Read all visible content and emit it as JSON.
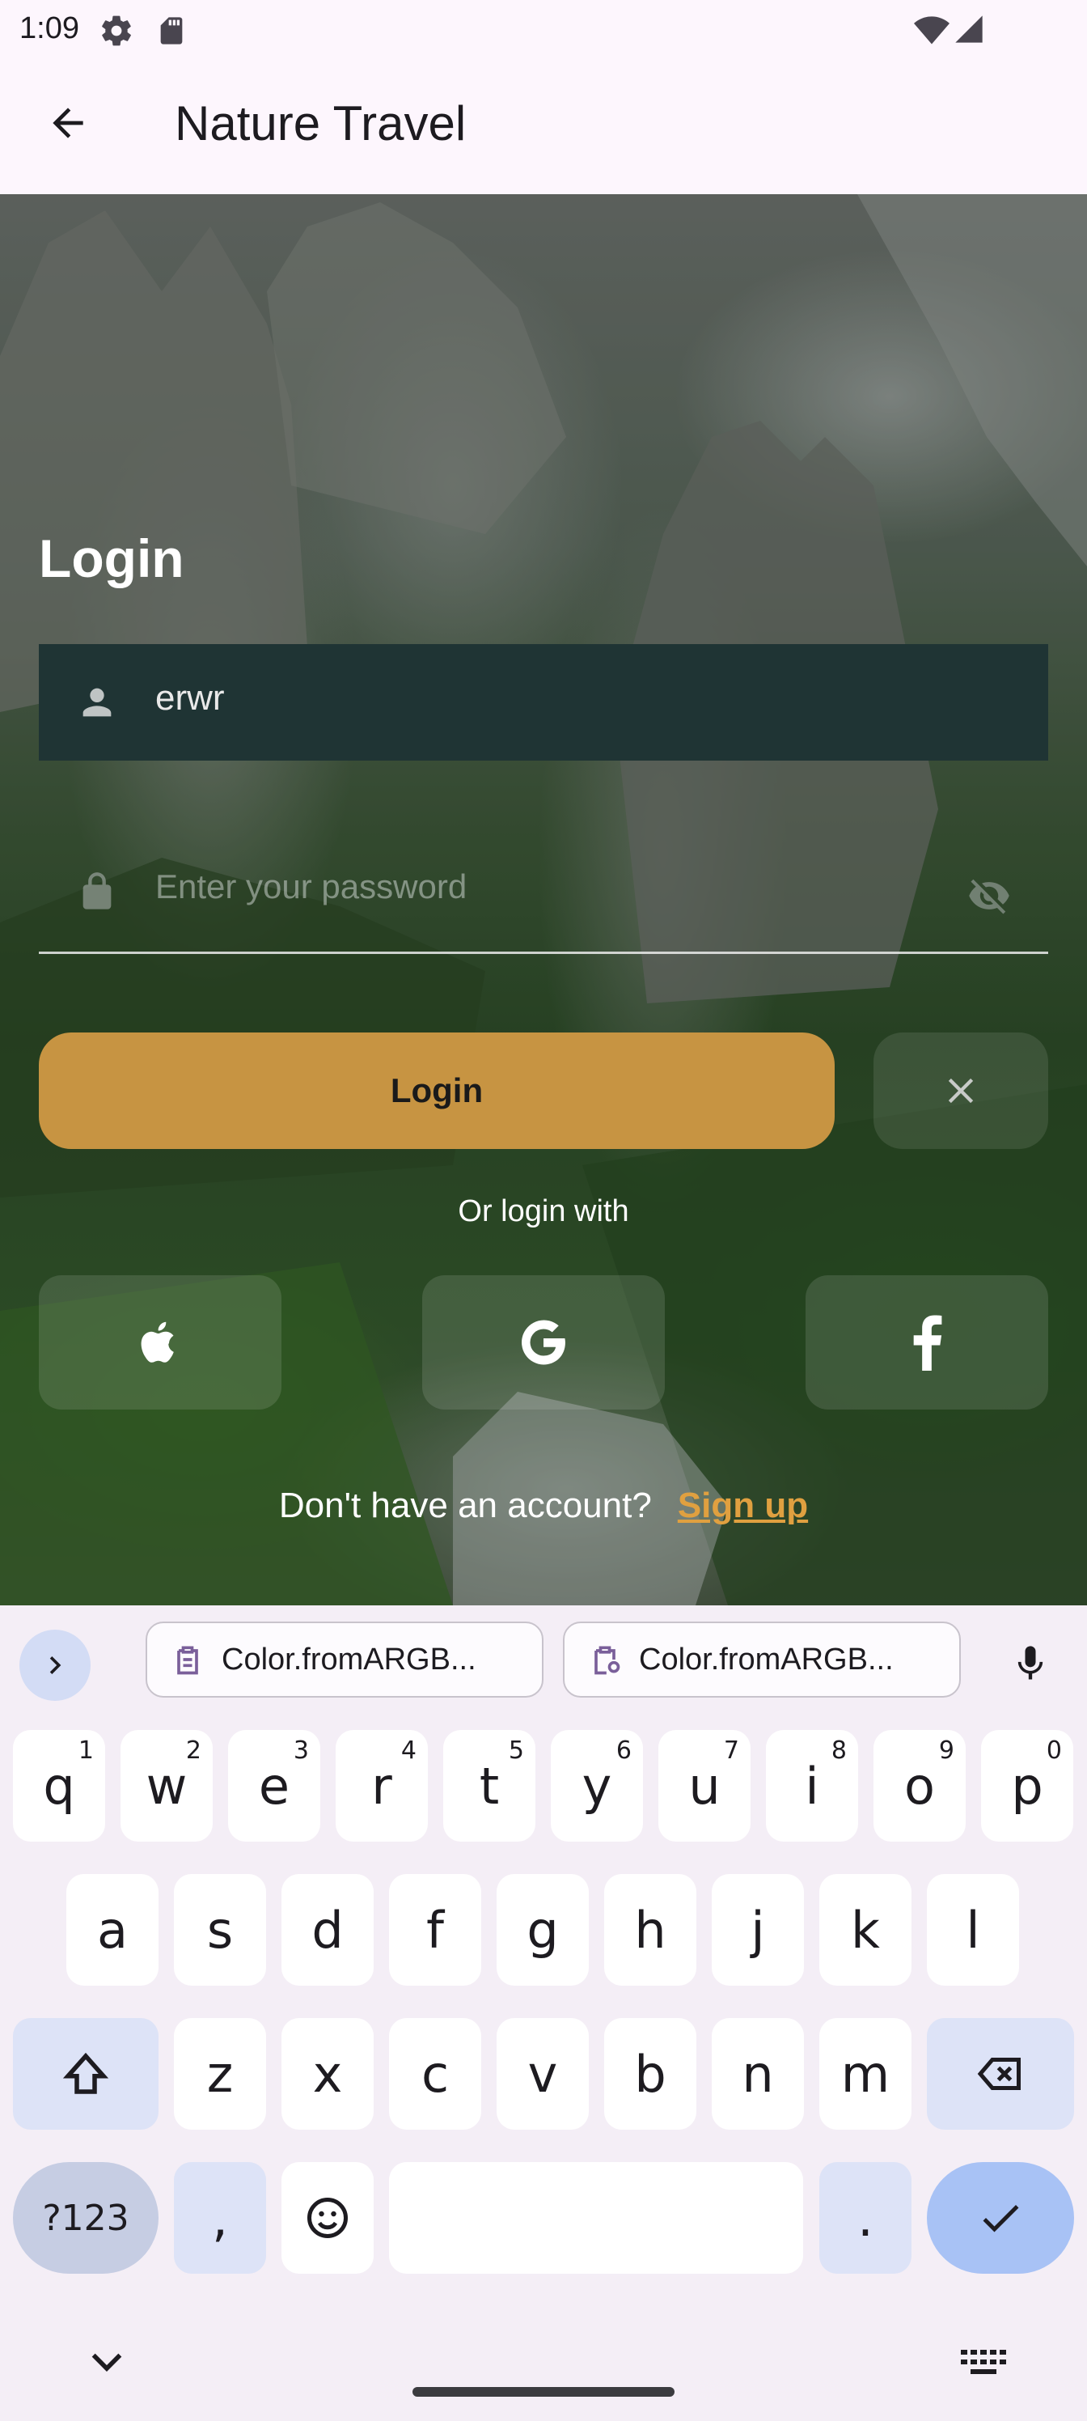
{
  "status": {
    "time": "1:09"
  },
  "appbar": {
    "title": "Nature Travel"
  },
  "login": {
    "heading": "Login",
    "username_value": "erwr",
    "password_placeholder": "Enter your password",
    "login_button": "Login",
    "or_text": "Or login with",
    "no_account_text": "Don't have an account?",
    "signup_link": "Sign up",
    "social_icons": [
      "apple-icon",
      "google-icon",
      "facebook-icon"
    ]
  },
  "keyboard": {
    "suggestions": [
      "Color.fromARGB...",
      "Color.fromARGB..."
    ],
    "row1": [
      {
        "k": "q",
        "h": "1"
      },
      {
        "k": "w",
        "h": "2"
      },
      {
        "k": "e",
        "h": "3"
      },
      {
        "k": "r",
        "h": "4"
      },
      {
        "k": "t",
        "h": "5"
      },
      {
        "k": "y",
        "h": "6"
      },
      {
        "k": "u",
        "h": "7"
      },
      {
        "k": "i",
        "h": "8"
      },
      {
        "k": "o",
        "h": "9"
      },
      {
        "k": "p",
        "h": "0"
      }
    ],
    "row2": [
      "a",
      "s",
      "d",
      "f",
      "g",
      "h",
      "j",
      "k",
      "l"
    ],
    "row3": [
      "z",
      "x",
      "c",
      "v",
      "b",
      "n",
      "m"
    ],
    "symbols_key": "?123",
    "comma_key": ",",
    "period_key": "."
  },
  "colors": {
    "accent": "#c79442",
    "signup": "#e0a040",
    "field": "#1f3434"
  }
}
